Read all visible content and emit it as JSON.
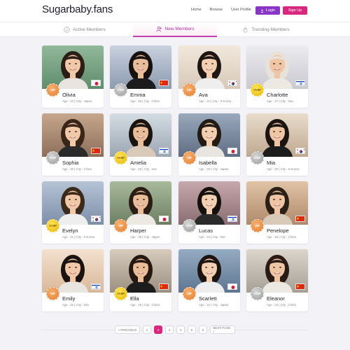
{
  "header": {
    "brand": "Sugarbaby.fans",
    "nav": [
      "Home",
      "Browse",
      "User Profile"
    ],
    "login": "Login",
    "signup": "Sign Up"
  },
  "tabs": [
    {
      "label": "Active Members",
      "icon": "check-circle-icon",
      "active": false
    },
    {
      "label": "New Members",
      "icon": "add-user-icon",
      "active": true
    },
    {
      "label": "Trending Members",
      "icon": "flame-icon",
      "active": false
    }
  ],
  "members": [
    {
      "name": "Olivia",
      "meta": "Age : 23  |  City : Japan",
      "badge": "VIP",
      "flag": "japan"
    },
    {
      "name": "Emma",
      "meta": "Age : 26  |  City : China",
      "badge": "VVIP",
      "flag": "china"
    },
    {
      "name": "Ava",
      "meta": "Age : 21  |  City : S.Korea",
      "badge": "VIP",
      "flag": "korea"
    },
    {
      "name": "Charlotte",
      "meta": "Age : 27  |  City : Iran",
      "badge": "VVIIP",
      "flag": "israel"
    },
    {
      "name": "Sophia",
      "meta": "Age : 30  |  City : China",
      "badge": "VVIP",
      "flag": "china"
    },
    {
      "name": "Amelia",
      "meta": "Age : 26  |  City : Iran",
      "badge": "VVIIP",
      "flag": "israel"
    },
    {
      "name": "Isabella",
      "meta": "Age : 26  |  City : Japan",
      "badge": "VIP",
      "flag": "japan"
    },
    {
      "name": "Mia",
      "meta": "Age : 20  |  City : S.Korea",
      "badge": "VVIP",
      "flag": "korea"
    },
    {
      "name": "Evelyn",
      "meta": "Age : 21  |  City : S.Korea",
      "badge": "VVIIP",
      "flag": "korea"
    },
    {
      "name": "Harper",
      "meta": "Age : 25  |  City : Japan",
      "badge": "VIP",
      "flag": "japan"
    },
    {
      "name": "Lucas",
      "meta": "Age : 24  |  City : Iran",
      "badge": "VVIP",
      "flag": "israel"
    },
    {
      "name": "Penelope",
      "meta": "Age : 26  |  City : China",
      "badge": "VIP",
      "flag": "china"
    },
    {
      "name": "Emily",
      "meta": "Age : 32  |  City : Iran",
      "badge": "VIP",
      "flag": "israel"
    },
    {
      "name": "Ella",
      "meta": "Age : 25  |  City : China",
      "badge": "VVIIP",
      "flag": "china"
    },
    {
      "name": "Scarlett",
      "meta": "Age : 22  |  City : Japan",
      "badge": "VIP",
      "flag": "japan"
    },
    {
      "name": "Eleanor",
      "meta": "Age : 34  |  City : China",
      "badge": "VVIP",
      "flag": "china"
    }
  ],
  "pagination": {
    "prev": "« PREVIOUS",
    "pages": [
      "1",
      "2",
      "3",
      "4",
      "5",
      "6"
    ],
    "current": "2",
    "next": "NEXT PAGE »"
  },
  "colors": {
    "login": "#8a35c7",
    "signup": "#d9267e",
    "active_tab": "#b02aa0"
  }
}
